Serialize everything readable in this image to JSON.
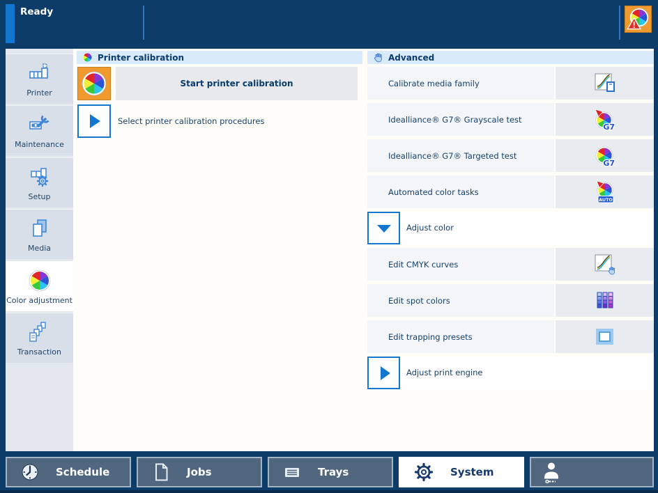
{
  "status_bar": {
    "status": "Ready"
  },
  "sidebar": {
    "items": [
      {
        "label": "Printer",
        "icon": "printer-icon",
        "selected": false
      },
      {
        "label": "Maintenance",
        "icon": "maintenance-icon",
        "selected": false
      },
      {
        "label": "Setup",
        "icon": "setup-icon",
        "selected": false
      },
      {
        "label": "Media",
        "icon": "media-icon",
        "selected": false
      },
      {
        "label": "Color adjustment",
        "icon": "color-wheel-icon",
        "selected": true
      },
      {
        "label": "Transaction",
        "icon": "transaction-icon",
        "selected": false
      }
    ]
  },
  "calibration_panel": {
    "title": "Printer calibration",
    "start_button_label": "Start printer calibration",
    "select_procedures_label": "Select printer calibration procedures"
  },
  "advanced_panel": {
    "title": "Advanced",
    "rows": [
      {
        "label": "Calibrate media family",
        "icon": "calibrate-media-icon"
      },
      {
        "label": "Idealliance® G7® Grayscale test",
        "icon": "g7-grayscale-icon"
      },
      {
        "label": "Idealliance® G7® Targeted test",
        "icon": "g7-targeted-icon"
      },
      {
        "label": "Automated color tasks",
        "icon": "auto-color-icon"
      },
      {
        "label": "Adjust color",
        "icon": "collapse-triangle-icon",
        "expanded": true
      },
      {
        "label": "Edit CMYK curves",
        "icon": "cmyk-curves-icon"
      },
      {
        "label": "Edit spot colors",
        "icon": "spot-colors-icon"
      },
      {
        "label": "Edit trapping presets",
        "icon": "trapping-icon"
      },
      {
        "label": "Adjust print engine",
        "icon": "expand-triangle-icon",
        "expanded": false
      }
    ]
  },
  "bottom_nav": {
    "tabs": [
      {
        "label": "Schedule",
        "icon": "clock-icon",
        "selected": false
      },
      {
        "label": "Jobs",
        "icon": "document-icon",
        "selected": false
      },
      {
        "label": "Trays",
        "icon": "tray-icon",
        "selected": false
      },
      {
        "label": "System",
        "icon": "gear-icon",
        "selected": true
      }
    ],
    "user_button_icon": "user-key-icon"
  },
  "icons": {
    "g7_label": "G7",
    "auto_label": "AUTO"
  },
  "colors": {
    "navy": "#0e3c69",
    "accent_blue": "#1377d0",
    "header_blue": "#d9eafb",
    "orange": "#f0992e",
    "row_label_bg": "#f3f5f8",
    "row_icon_bg": "#e8ecf1",
    "tile_bg": "#d8dfe8",
    "tile_selected": "#ffffff",
    "slate_button": "#50677f",
    "selected_tab": "#ffffff",
    "warning_red": "#e03028"
  }
}
